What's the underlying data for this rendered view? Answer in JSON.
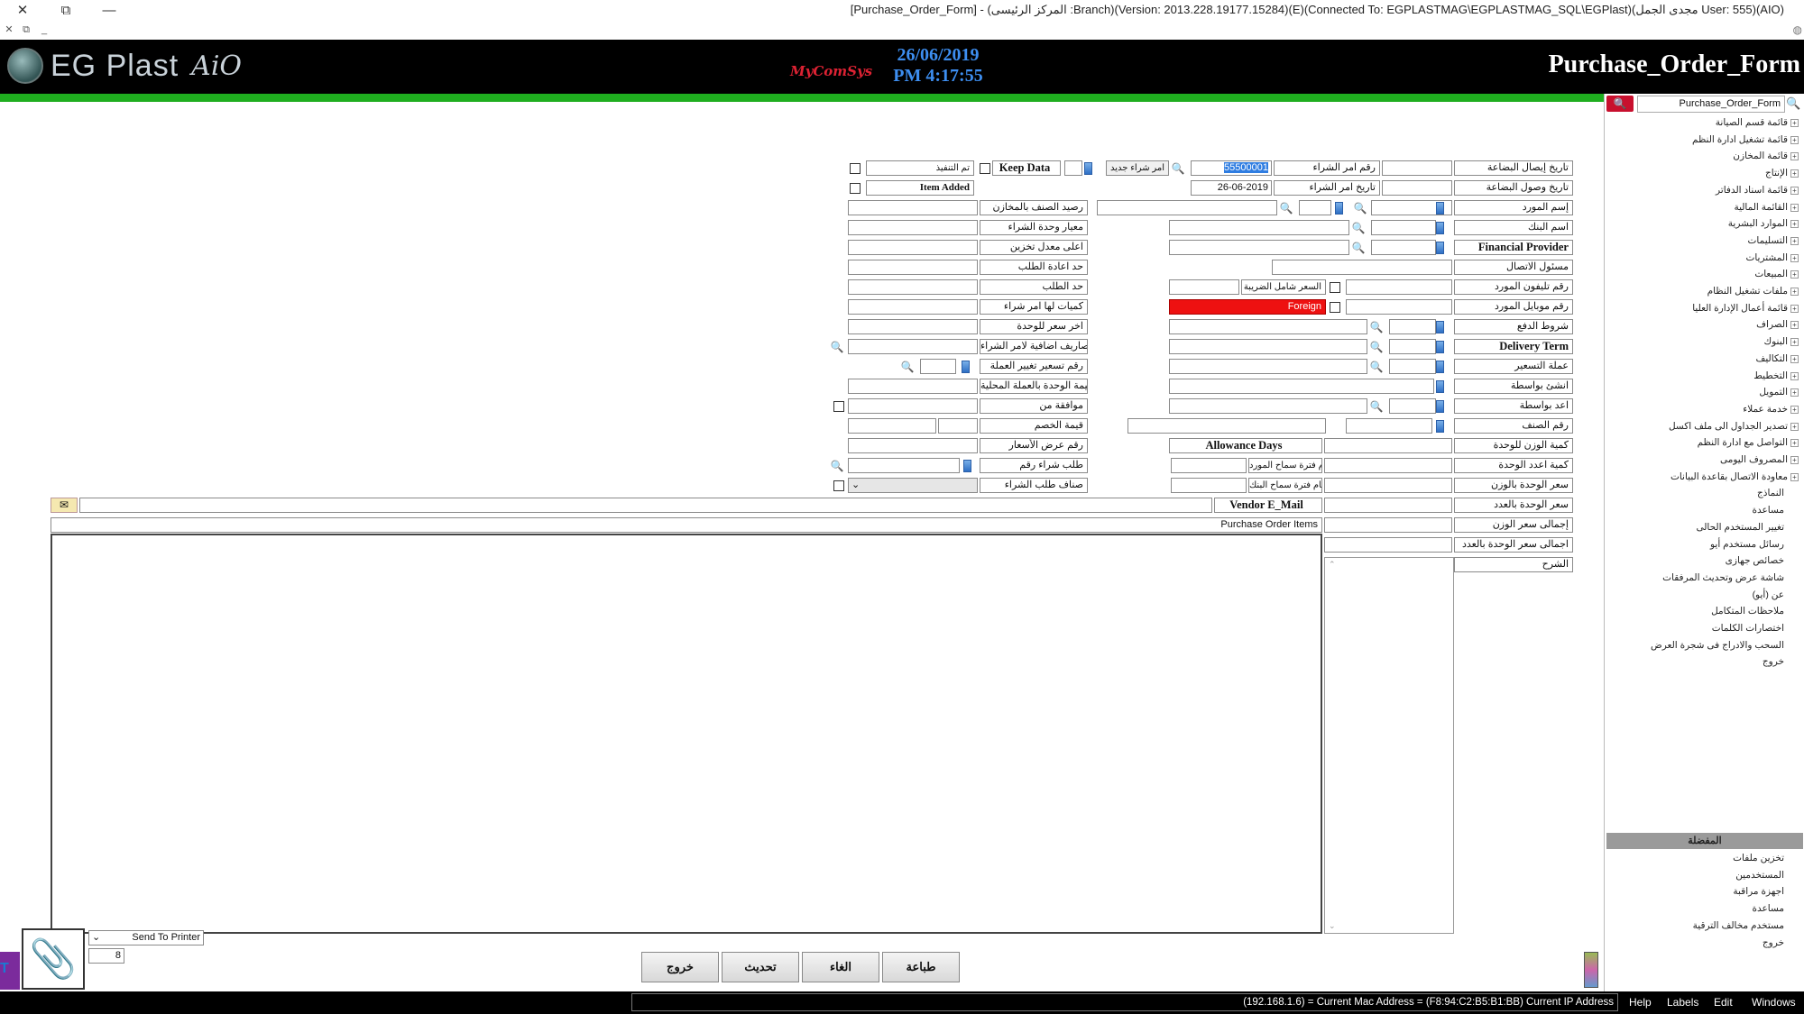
{
  "window": {
    "title": "[Purchase_Order_Form] - (المركز الرئيسى :Branch)(Version: 2013.228.19177.15284)(E)(Connected To: EGPLASTMAG\\EGPLASTMAG_SQL\\EGPlast)(مجدى الجمل User: 555)(AIO)",
    "close": "✕",
    "restore": "⧉",
    "minimize": "—"
  },
  "header": {
    "logo_text": "EG Plast",
    "logo_suffix": "AiO",
    "vendor_logo": "MyComSys",
    "date": "26/06/2019",
    "time": "PM 4:17:55",
    "form_name": "Purchase_Order_Form"
  },
  "sidebar": {
    "search_value": "Purchase_Order_Form",
    "search_icon": "🔍",
    "items": [
      "قائمة قسم الصيانة",
      "قائمة تشغيل ادارة النظم",
      "قائمة المخازن",
      "الإنتاج",
      "قائمة اسناد الدفاتر",
      "القائمة المالية",
      "الموارد البشرية",
      "التسليمات",
      "المشتريات",
      "المبيعات",
      "ملفات تشغيل النظام",
      "قائمة أعمال الإدارة العليا",
      "الصراف",
      "البنوك",
      "التكاليف",
      "التخطيط",
      "التمويل",
      "خدمة عملاء",
      "تصدير الجداول الى ملف اكسل",
      "التواصل مع ادارة النظم",
      "المصروف اليومى",
      "معاودة الاتصال بقاعدة البيانات",
      "النماذج",
      "مساعدة",
      "تغيير المستخدم الحالى",
      "رسائل مستخدم أيو",
      "خصائص جهازى",
      "شاشة عرض وتحديث المرفقات",
      "عن (أيو)",
      "ملاحظات المتكامل",
      "اختصارات الكلمات",
      "السحب والادراج فى شجرة العرض",
      "خروج"
    ],
    "favorites_header": "المفضلة",
    "favorites": [
      "تخزين ملفات",
      "المستخدمين",
      "اجهزة مراقبة",
      "مساعدة",
      "مستخدم مخالف الترقية",
      "خروج"
    ]
  },
  "form": {
    "right_labels": [
      "تاريخ إيصال البضاعة",
      "تاريخ وصول البضاعة",
      "إسم المورد",
      "اسم البنك",
      "Financial Provider",
      "مسئول الاتصال",
      "رقم تليفون المورد",
      "رقم موبايل المورد",
      "شروط الدفع",
      "Delivery Term",
      "عملة التسعير",
      "انشئ بواسطة",
      "اعد بواسطة",
      "رقم الصنف",
      "كمية الوزن للوحدة",
      "كمية اعدد الوحدة",
      "سعر الوحدة بالوزن",
      "سعر الوحدة بالعدد",
      "إجمالى سعر الوزن",
      "اجمالى سعر الوحدة بالعدد",
      "الشرح"
    ],
    "po_number_label": "رقم امر الشراء",
    "po_number_value": "55500001",
    "po_date_label": "تاريخ امر الشراء",
    "po_date_value": "26-06-2019",
    "new_po_label": "امر شراء جديد",
    "keep_data": "Keep Data",
    "executed": "تم التنفيذ",
    "item_added": "Item Added",
    "tax_inclusive": "السعر شامل الضريبة",
    "foreign": "Foreign",
    "allowance_days": "Allowance Days",
    "supplier_allowance": "عدد ايام فترة سماح المورد",
    "bank_allowance": "عدد ايام فترة سماح البنك",
    "vendor_email": "Vendor E_Mail",
    "po_items": "Purchase Order Items",
    "middle_labels": [
      "رصيد الصنف بالمخازن",
      "معيار وحدة الشراء",
      "اعلى معدل تخزين",
      "حد اعادة الطلب",
      "حد الطلب",
      "كميات لها امر شراء",
      "اخر سعر للوحدة",
      "مصاريف اضافية لامر الشراء",
      "رقم تسعير تغيير العملة",
      "قيمة الوحدة بالعملة المحلية",
      "موافقة من",
      "قيمة الخصم",
      "رقم عرض الأسعار",
      "طلب شراء رقم",
      "صناف طلب الشراء"
    ]
  },
  "bottom": {
    "send_to_printer": "Send To Printer",
    "copies": "8",
    "buttons": [
      "طباعة",
      "الغاء",
      "تحديث",
      "خروج"
    ]
  },
  "statusbar": {
    "message": "(192.168.1.6) = Current Mac Address = (F8:94:C2:B5:B1:BB) Current IP Address",
    "menus": [
      "Help",
      "Labels",
      "Edit",
      "Windows"
    ]
  }
}
